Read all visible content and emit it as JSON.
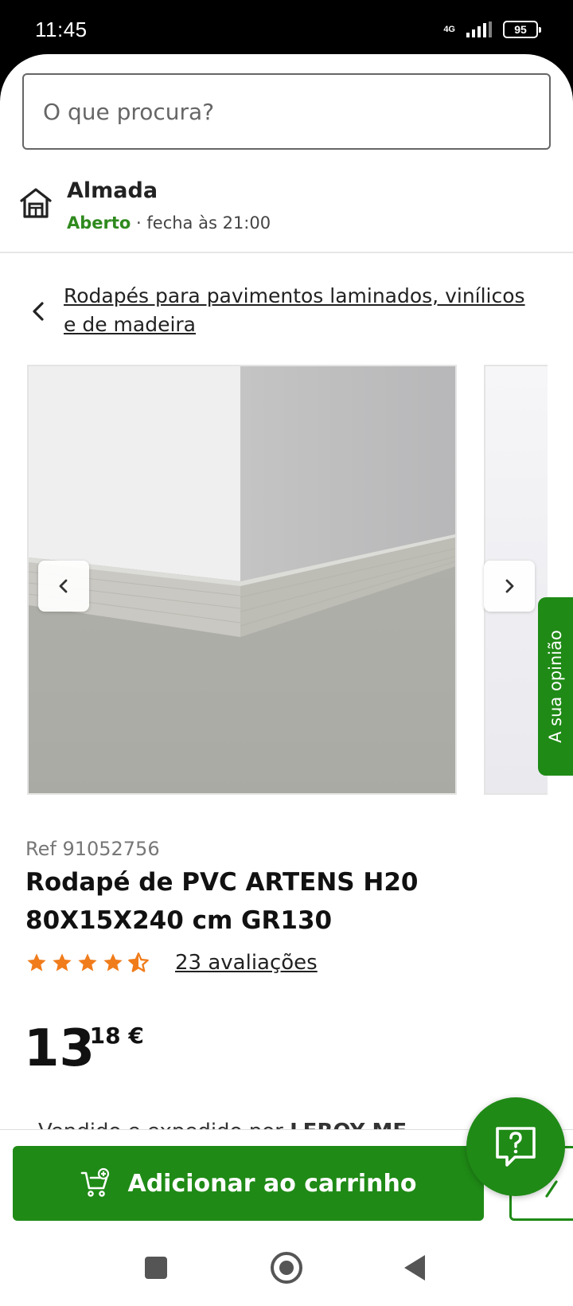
{
  "status_bar": {
    "time": "11:45",
    "network": "4G",
    "battery": "95"
  },
  "search": {
    "placeholder": "O que procura?"
  },
  "store": {
    "name": "Almada",
    "status_open": "Aberto",
    "status_close": " · fecha às 21:00"
  },
  "breadcrumb": {
    "label": "Rodapés para pavimentos laminados, vinílicos e de madeira"
  },
  "feedback": {
    "label": "A sua opinião"
  },
  "product": {
    "ref": "Ref 91052756",
    "title": "Rodapé de PVC ARTENS H20 80X15X240 cm GR130",
    "rating": 4.5,
    "reviews": "23 avaliações",
    "price_integer": "13",
    "price_decimal": ",18 €"
  },
  "seller": {
    "prefix": "Vendido e expedido por ",
    "name": "LEROY ME"
  },
  "actions": {
    "add_to_cart": "Adicionar ao carrinho"
  },
  "colors": {
    "brand_green": "#1f8a16",
    "open_green": "#2f8a1e",
    "star_orange": "#f07c1b"
  },
  "icons": [
    "store-icon",
    "chevron-left-icon",
    "chevron-right-icon",
    "star-icon",
    "cart-add-icon",
    "help-icon",
    "list-icon"
  ]
}
